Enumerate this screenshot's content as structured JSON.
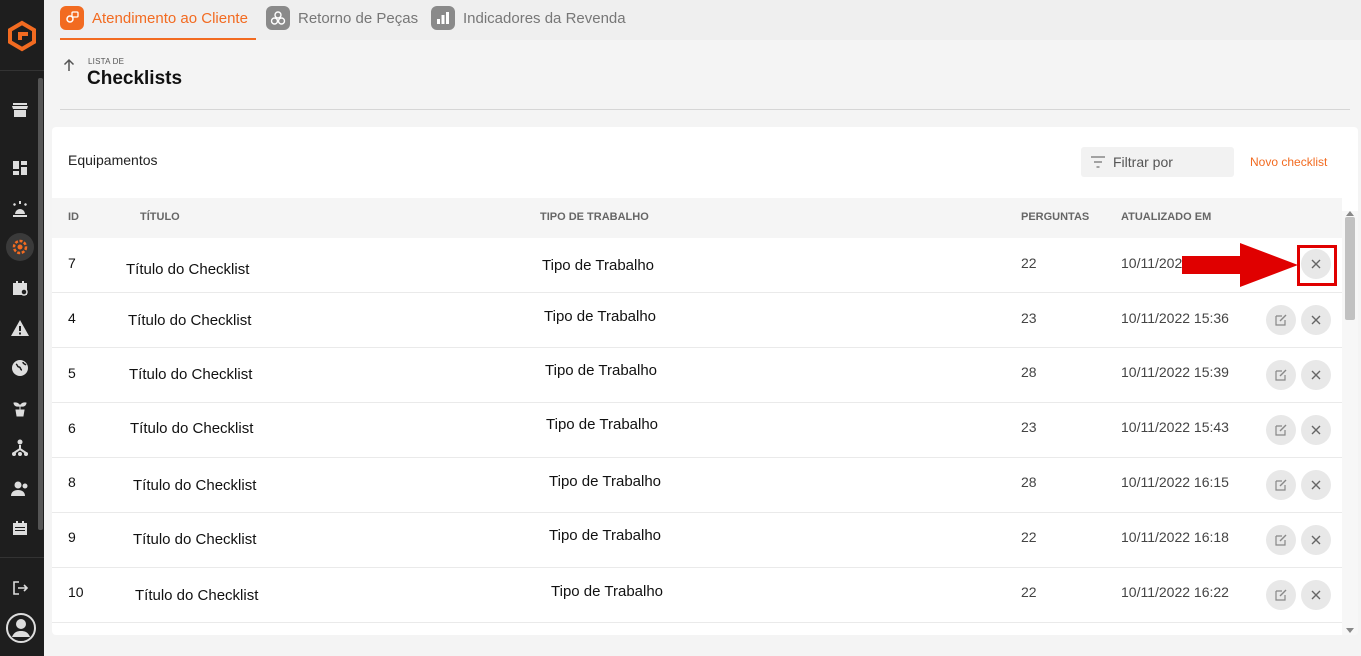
{
  "colors": {
    "accent": "#f26b21",
    "sidebar": "#1e1e1e",
    "annotation": "#e00000"
  },
  "sidebar": {
    "icons": [
      "logo-icon",
      "store-icon",
      "dashboard-icon",
      "alarm-icon",
      "gear-service-icon",
      "calendar-check-icon",
      "warning-icon",
      "globe-icon",
      "plant-icon",
      "hierarchy-icon",
      "users-icon",
      "calendar-icon",
      "logout-icon",
      "user-avatar-icon"
    ]
  },
  "tabs": [
    {
      "label": "Atendimento ao Cliente",
      "icon": "headset-icon"
    },
    {
      "label": "Retorno de Peças",
      "icon": "parts-icon"
    },
    {
      "label": "Indicadores da Revenda",
      "icon": "chart-icon"
    }
  ],
  "header": {
    "eyebrow": "LISTA DE",
    "title": "Checklists"
  },
  "card": {
    "title": "Equipamentos",
    "filter_label": "Filtrar por",
    "new_label": "Novo checklist"
  },
  "table": {
    "columns": {
      "id": "ID",
      "title": "TÍTULO",
      "work_type": "TIPO DE TRABALHO",
      "questions": "PERGUNTAS",
      "updated": "ATUALIZADO EM"
    },
    "rows": [
      {
        "id": "7",
        "title": "Título do Checklist",
        "work_type": "Tipo de Trabalho",
        "questions": "22",
        "updated": "10/11/2022"
      },
      {
        "id": "4",
        "title": "Título do Checklist",
        "work_type": "Tipo de Trabalho",
        "questions": "23",
        "updated": "10/11/2022 15:36"
      },
      {
        "id": "5",
        "title": "Título do Checklist",
        "work_type": "Tipo de Trabalho",
        "questions": "28",
        "updated": "10/11/2022 15:39"
      },
      {
        "id": "6",
        "title": "Título do Checklist",
        "work_type": "Tipo de Trabalho",
        "questions": "23",
        "updated": "10/11/2022 15:43"
      },
      {
        "id": "8",
        "title": "Título do Checklist",
        "work_type": "Tipo de Trabalho",
        "questions": "28",
        "updated": "10/11/2022 16:15"
      },
      {
        "id": "9",
        "title": "Título do Checklist",
        "work_type": "Tipo de Trabalho",
        "questions": "22",
        "updated": "10/11/2022 16:18"
      },
      {
        "id": "10",
        "title": "Título do Checklist",
        "work_type": "Tipo de Trabalho",
        "questions": "22",
        "updated": "10/11/2022 16:22"
      }
    ]
  }
}
